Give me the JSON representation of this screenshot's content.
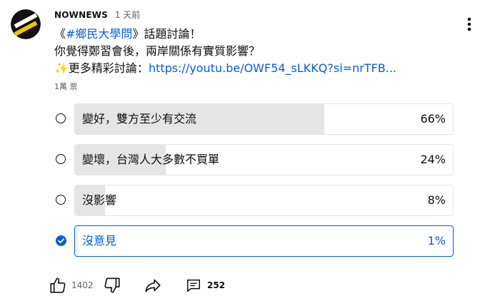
{
  "post": {
    "channel": "NOWNEWS",
    "time": "1 天前",
    "text": {
      "line1_open": "《",
      "line1_hashtag": "#鄉民大學問",
      "line1_rest": "》話題討論！",
      "line2": "你覺得鄭習會後，兩岸關係有實質影響？",
      "line3_emoji": "✨",
      "line3_text": "更多精彩討論：",
      "line3_link": "https://youtu.be/OWF54_sLKKQ?si=nrTFB..."
    },
    "votes": "1萬 票"
  },
  "poll": {
    "options": [
      {
        "label": "變好，雙方至少有交流",
        "percent_text": "66%",
        "percent": 66,
        "selected": false
      },
      {
        "label": "變壞，台灣人大多數不買單",
        "percent_text": "24%",
        "percent": 24,
        "selected": false
      },
      {
        "label": "沒影響",
        "percent_text": "8%",
        "percent": 8,
        "selected": false
      },
      {
        "label": "沒意見",
        "percent_text": "1%",
        "percent": 1,
        "selected": true
      }
    ]
  },
  "actions": {
    "like_count": "1402",
    "comment_count": "252"
  },
  "colors": {
    "accent": "#065fd4",
    "fill": "#e5e5e5",
    "muted": "#606060"
  },
  "icons": {
    "avatar": "nownews-logo",
    "more": "more-vert-icon",
    "like": "thumb-up-icon",
    "dislike": "thumb-down-icon",
    "share": "share-icon",
    "comment": "comment-icon"
  }
}
